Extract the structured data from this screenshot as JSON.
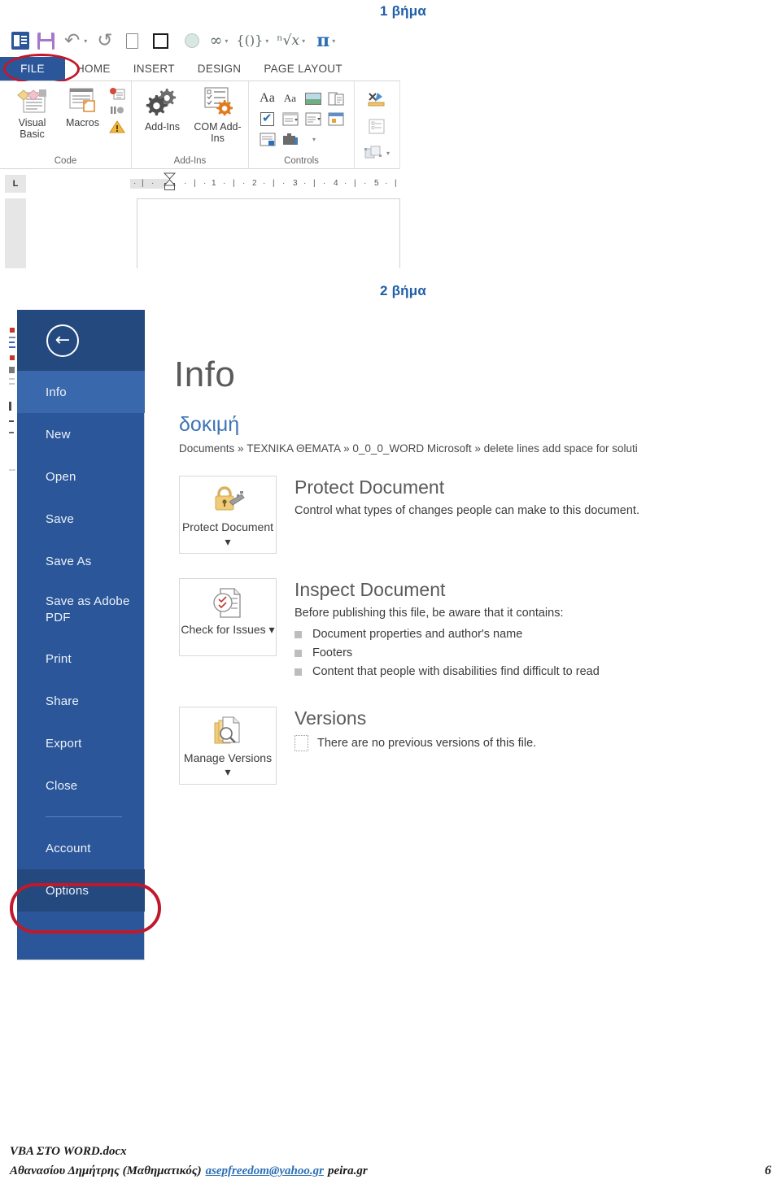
{
  "steps": {
    "step1": "1 βήμα",
    "step2": "2 βήμα"
  },
  "ribbon": {
    "quick_access": [
      {
        "name": "word-icon",
        "label": "W"
      },
      {
        "name": "save-icon",
        "label": ""
      },
      {
        "name": "undo-icon",
        "label": "↶"
      },
      {
        "name": "redo-icon",
        "label": "↺"
      },
      {
        "name": "new-document-icon",
        "label": ""
      },
      {
        "name": "square-icon",
        "label": ""
      },
      {
        "name": "circle-icon",
        "label": ""
      },
      {
        "name": "infinity-icon",
        "label": "∞"
      },
      {
        "name": "braces-icon",
        "label": "{()}"
      },
      {
        "name": "radical-icon",
        "label": "ⁿ√x"
      },
      {
        "name": "pi-icon",
        "label": "π"
      }
    ],
    "tabs": [
      {
        "label": "FILE",
        "active": true,
        "highlighted": true
      },
      {
        "label": "HOME",
        "active": false
      },
      {
        "label": "INSERT",
        "active": false
      },
      {
        "label": "DESIGN",
        "active": false
      },
      {
        "label": "PAGE LAYOUT",
        "active": false
      }
    ],
    "groups": [
      {
        "label": "Code",
        "buttons": [
          {
            "label": "Visual Basic",
            "icon": "visual-basic-icon"
          },
          {
            "label": "Macros",
            "icon": "macros-icon"
          }
        ],
        "mini_icons": [
          "record-macro-icon",
          "pause-recording-icon",
          "macro-security-icon"
        ]
      },
      {
        "label": "Add-Ins",
        "buttons": [
          {
            "label": "Add-Ins",
            "icon": "addins-icon"
          },
          {
            "label": "COM Add-Ins",
            "icon": "com-addins-icon"
          }
        ],
        "mini_icons": []
      },
      {
        "label": "Controls",
        "buttons": [],
        "mini_icons": [
          "rich-text-content-control-icon",
          "plain-text-content-control-icon",
          "picture-content-control-icon",
          "building-block-gallery-icon",
          "check-box-content-control-icon",
          "combo-box-content-control-icon",
          "drop-down-list-content-control-icon",
          "date-picker-content-control-icon",
          "repeating-section-content-control-icon",
          "legacy-tools-icon"
        ]
      },
      {
        "label": "",
        "buttons": [],
        "mini_icons": [
          "design-mode-icon",
          "properties-icon",
          "group-icon"
        ]
      }
    ],
    "ruler": {
      "tab_stop": "L",
      "ticks": [
        "1",
        "2",
        "3",
        "4",
        "5"
      ]
    }
  },
  "backstage": {
    "back_button": "←",
    "menu": [
      {
        "label": "Info",
        "state": "active"
      },
      {
        "label": "New",
        "state": "normal"
      },
      {
        "label": "Open",
        "state": "normal"
      },
      {
        "label": "Save",
        "state": "normal"
      },
      {
        "label": "Save As",
        "state": "normal"
      },
      {
        "label": "Save as Adobe PDF",
        "state": "normal"
      },
      {
        "label": "Print",
        "state": "normal"
      },
      {
        "label": "Share",
        "state": "normal"
      },
      {
        "label": "Export",
        "state": "normal"
      },
      {
        "label": "Close",
        "state": "normal"
      },
      {
        "label": "Account",
        "state": "normal"
      },
      {
        "label": "Options",
        "state": "highlighted"
      }
    ],
    "title": "Info",
    "document_name": "δοκιμή",
    "document_path": "Documents » ΤΕΧΝΙΚΑ ΘΕΜΑΤΑ » 0_0_0_WORD Microsoft » delete lines add space for soluti",
    "sections": [
      {
        "tile_label": "Protect Document ▾",
        "tile_icon": "lock-key-icon",
        "heading": "Protect Document",
        "description": "Control what types of changes people can make to this document.",
        "items": []
      },
      {
        "tile_label": "Check for Issues ▾",
        "tile_icon": "inspect-document-icon",
        "heading": "Inspect Document",
        "description": "Before publishing this file, be aware that it contains:",
        "items": [
          "Document properties and author's name",
          "Footers",
          "Content that people with disabilities find difficult to read"
        ]
      },
      {
        "tile_label": "Manage Versions ▾",
        "tile_icon": "manage-versions-icon",
        "heading": "Versions",
        "description": "",
        "items": [
          "There are no previous versions of this file."
        ]
      }
    ]
  },
  "footer": {
    "file_name": "VBA ΣΤΟ WORD.docx",
    "author": "Αθανασίου Δημήτρης (Μαθηματικός)",
    "email": "asepfreedom@yahoo.gr",
    "site": "peira.gr",
    "page_number": "6"
  },
  "colors": {
    "word_blue": "#2b579a",
    "accent_blue": "#1f5ea8",
    "highlight_red": "#c0192b",
    "link_blue": "#2b6fb5"
  }
}
